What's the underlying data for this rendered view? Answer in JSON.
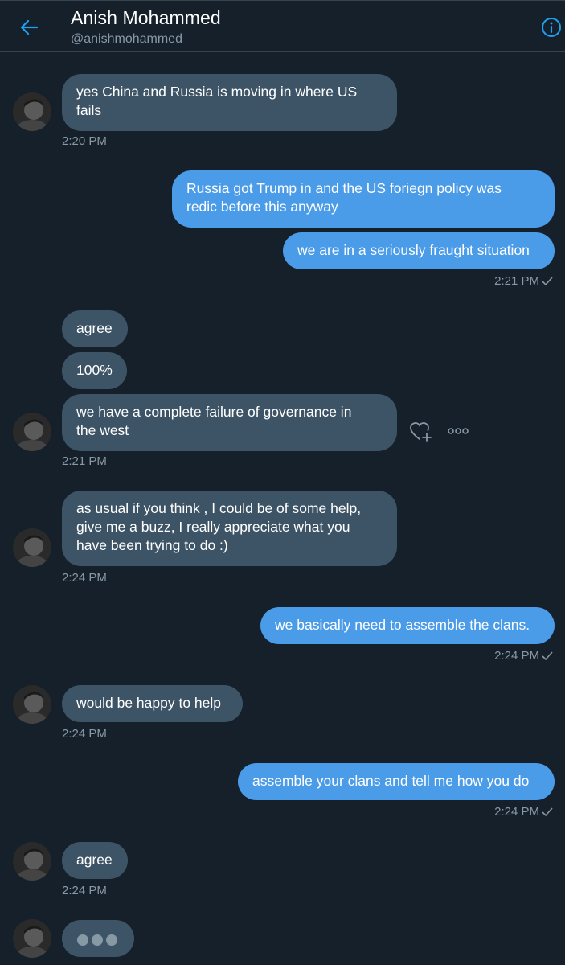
{
  "header": {
    "name": "Anish Mohammed",
    "handle": "@anishmohammed",
    "back_icon": "arrow-left-icon",
    "info_icon": "info-icon"
  },
  "colors": {
    "background": "#15202b",
    "incoming_bubble": "#3d5466",
    "outgoing_bubble": "#4a9be8",
    "accent": "#1da1f2",
    "muted_text": "#8899a6"
  },
  "messages": [
    {
      "from": "them",
      "text": [
        "yes China and Russia is moving in where US",
        "fails"
      ],
      "time": "2:20 PM"
    },
    {
      "from": "me",
      "text": [
        "Russia got Trump in and the US foriegn policy was",
        "redic before this anyway"
      ]
    },
    {
      "from": "me",
      "text": [
        "we are in a seriously fraught situation"
      ],
      "time": "2:21 PM"
    },
    {
      "from": "them",
      "text": [
        "agree"
      ]
    },
    {
      "from": "them",
      "text": [
        "100%"
      ]
    },
    {
      "from": "them",
      "text": [
        "we have a complete failure of governance in",
        "the west"
      ],
      "time": "2:21 PM"
    },
    {
      "from": "them",
      "text": [
        "as usual if you think , I could be of some help,",
        "give me a buzz, I really appreciate what you",
        "have been trying to do :)"
      ],
      "time": "2:24 PM"
    },
    {
      "from": "me",
      "text": [
        "we basically need to assemble the clans."
      ],
      "time": "2:24 PM"
    },
    {
      "from": "them",
      "text": [
        "would be happy to help"
      ],
      "time": "2:24 PM"
    },
    {
      "from": "me",
      "text": [
        "assemble your clans and tell me how you do"
      ],
      "time": "2:24 PM"
    },
    {
      "from": "them",
      "text": [
        "agree"
      ],
      "time": "2:24 PM"
    }
  ],
  "actions": {
    "like_icon": "heart-plus-icon",
    "more_icon": "more-options-icon"
  },
  "typing_indicator_icon": "typing-dots-icon"
}
